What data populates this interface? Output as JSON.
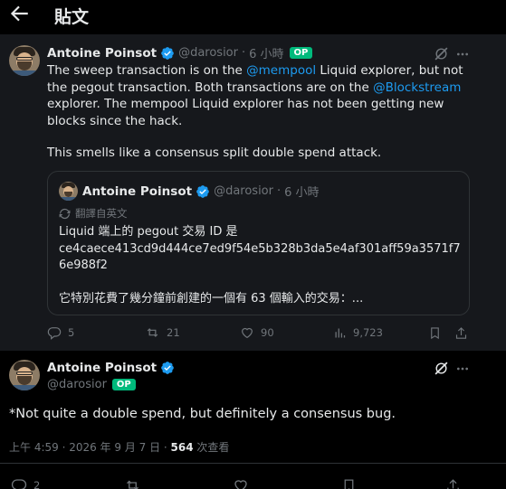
{
  "header": {
    "title": "貼文"
  },
  "parent_post": {
    "author_name": "Antoine Poinsot",
    "handle": "@darosior",
    "dot": "·",
    "time": "6 小時",
    "op_badge": "OP",
    "text_1": "The sweep transaction is on the ",
    "link_1": "@mempool",
    "text_2": " Liquid explorer, but not the pegout transaction. Both transactions are on the ",
    "link_2": "@Blockstream",
    "text_3": " explorer. The mempool Liquid explorer has not been getting new blocks since the hack.",
    "text_4": "This smells like a consensus split double spend attack.",
    "quote": {
      "author_name": "Antoine Poinsot",
      "handle": "@darosior",
      "dot": "·",
      "time": "6 小時",
      "translated": "翻譯自英文",
      "line_1": "Liquid 端上的 pegout 交易 ID 是",
      "line_2": "ce4caece413cd9d444ce7ed9f54e5b328b3da5e4af301aff59a3571f76e988f2",
      "line_3": "它特別花費了幾分鐘前創建的一個有 63 個輸入的交易：..."
    },
    "stats": {
      "replies": "5",
      "reposts": "21",
      "likes": "90",
      "views": "9,723"
    }
  },
  "main_post": {
    "author_name": "Antoine Poinsot",
    "handle": "@darosior",
    "op_badge": "OP",
    "text": "*Not quite a double spend, but definitely a consensus bug.",
    "time": "上午 4:59 · 2026 年 9 月 7 日 · ",
    "views_count": "564",
    "views_label": " 次查看",
    "stats": {
      "replies": "2"
    }
  },
  "colors": {
    "accent": "#1d9bf0",
    "op_badge": "#00ba7c",
    "muted": "#71767b"
  }
}
